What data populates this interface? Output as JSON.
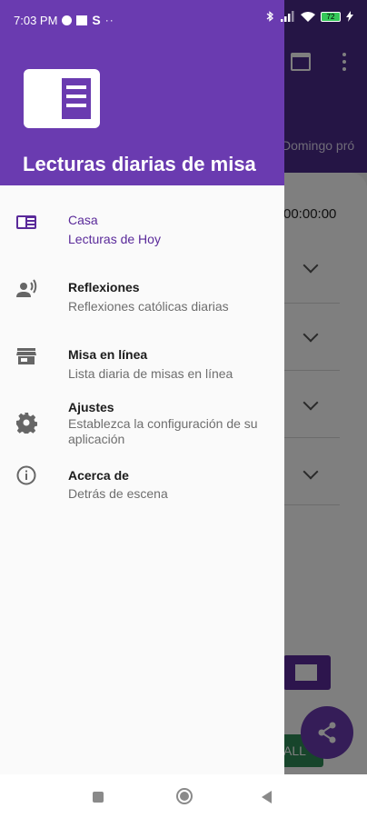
{
  "status_bar": {
    "time": "7:03 PM",
    "battery": "72",
    "extra_glyph": "S",
    "more_glyph": "··"
  },
  "background": {
    "date_text": "Domingo pró",
    "timer_text": "00:00:00",
    "call_text": "ALL"
  },
  "drawer": {
    "title": "Lecturas diarias de misa",
    "items": [
      {
        "title": "Casa",
        "subtitle": "Lecturas de Hoy",
        "icon": "book-icon",
        "active": true
      },
      {
        "title": "Reflexiones",
        "subtitle": "Reflexiones católicas diarias",
        "icon": "person-voice-icon",
        "active": false
      },
      {
        "title": "Misa en línea",
        "subtitle": "Lista diaria de misas en línea",
        "icon": "store-icon",
        "active": false
      },
      {
        "title": "Ajustes",
        "subtitle": "Establezca la configuración de su aplicación",
        "icon": "gear-icon",
        "active": false
      },
      {
        "title": "Acerca de",
        "subtitle": "Detrás de escena",
        "icon": "info-icon",
        "active": false
      }
    ]
  },
  "colors": {
    "accent": "#6a3bb0",
    "accent_dark": "#4a2a8a",
    "active_text": "#5a2a9a"
  }
}
